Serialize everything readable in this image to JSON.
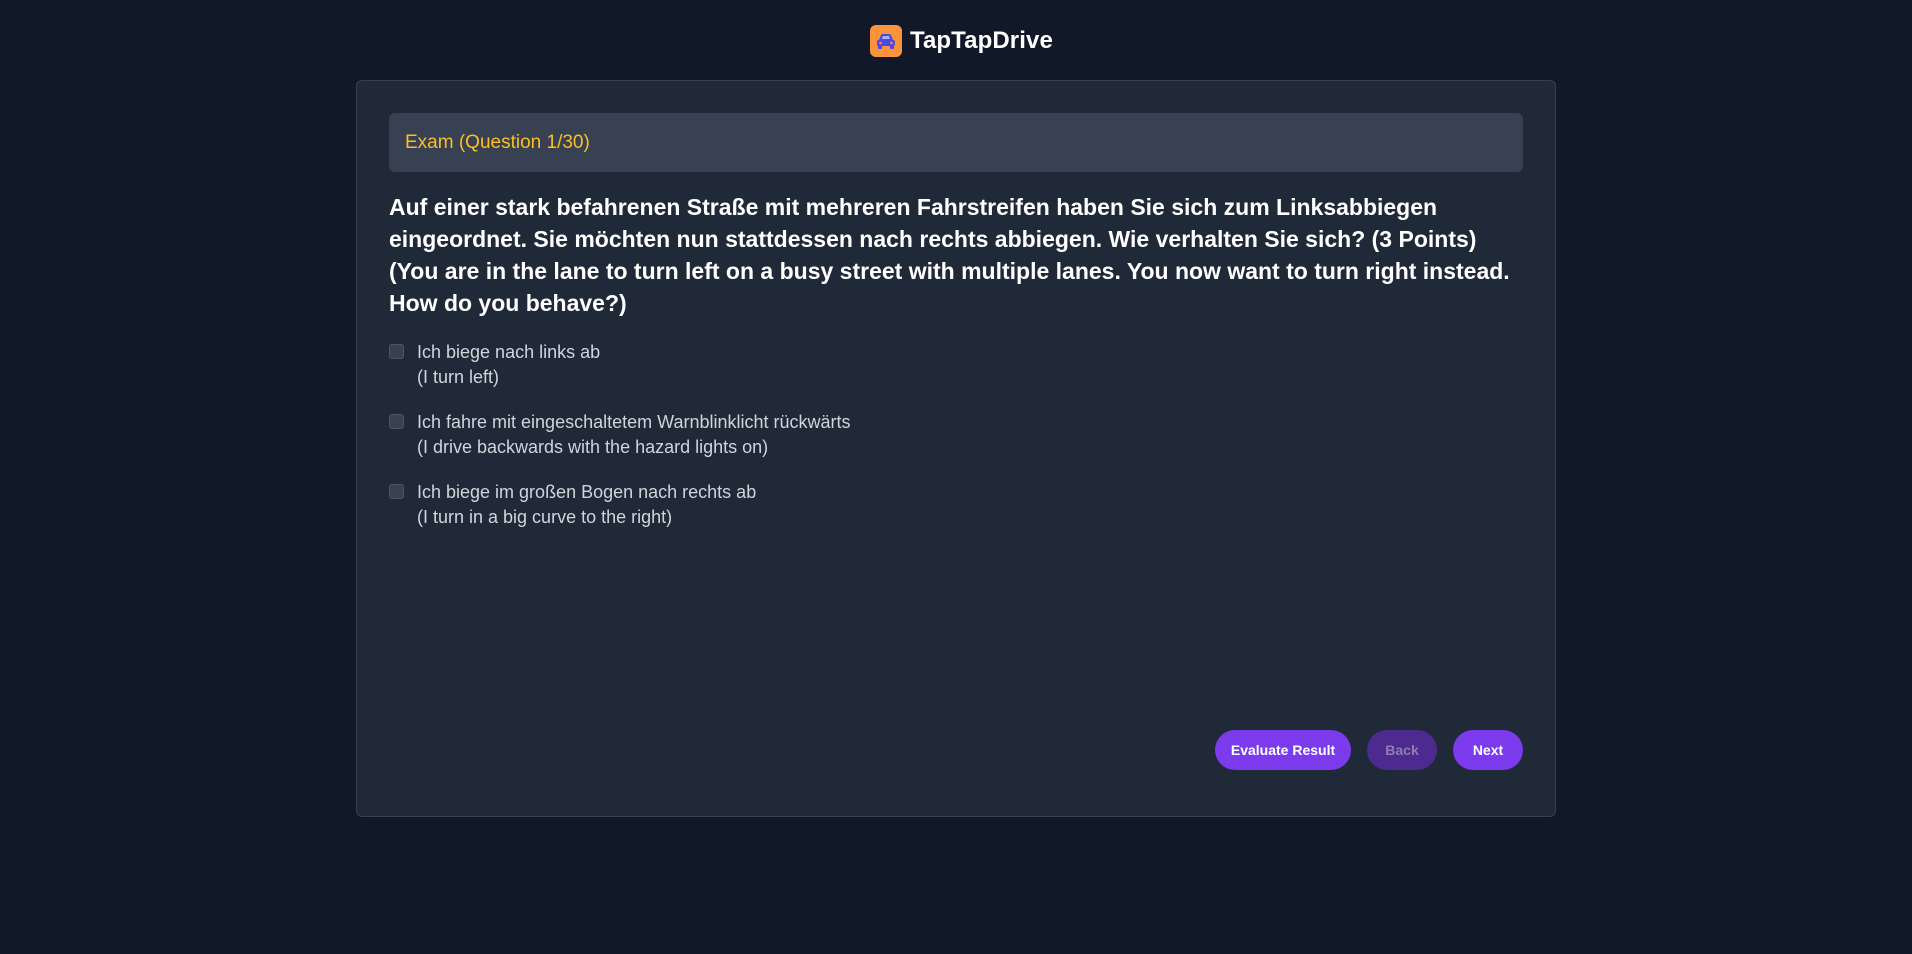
{
  "app": {
    "name": "TapTapDrive",
    "logo_icon": "car-icon",
    "colors": {
      "background": "#111827",
      "card": "#1f2937",
      "accent": "#7c3aed",
      "header_text": "#fbbf24",
      "logo": "#fb923c"
    }
  },
  "exam": {
    "header": "Exam (Question 1/30)",
    "question": {
      "german": "Auf einer stark befahrenen Straße mit mehreren Fahrstreifen haben Sie sich zum Linksabbiegen eingeordnet. Sie möchten nun stattdessen nach rechts abbiegen. Wie verhalten Sie sich? (3 Points)",
      "english": "(You are in the lane to turn left on a busy street with multiple lanes. You now want to turn right instead. How do you behave?)"
    },
    "answers": [
      {
        "german": "Ich biege nach links ab",
        "english": "(I turn left)",
        "checked": false
      },
      {
        "german": "Ich fahre mit eingeschaltetem Warnblinklicht rückwärts",
        "english": "(I drive backwards with the hazard lights on)",
        "checked": false
      },
      {
        "german": "Ich biege im großen Bogen nach rechts ab",
        "english": "(I turn in a big curve to the right)",
        "checked": false
      }
    ]
  },
  "buttons": {
    "evaluate": "Evaluate Result",
    "back": "Back",
    "next": "Next",
    "back_disabled": true
  }
}
